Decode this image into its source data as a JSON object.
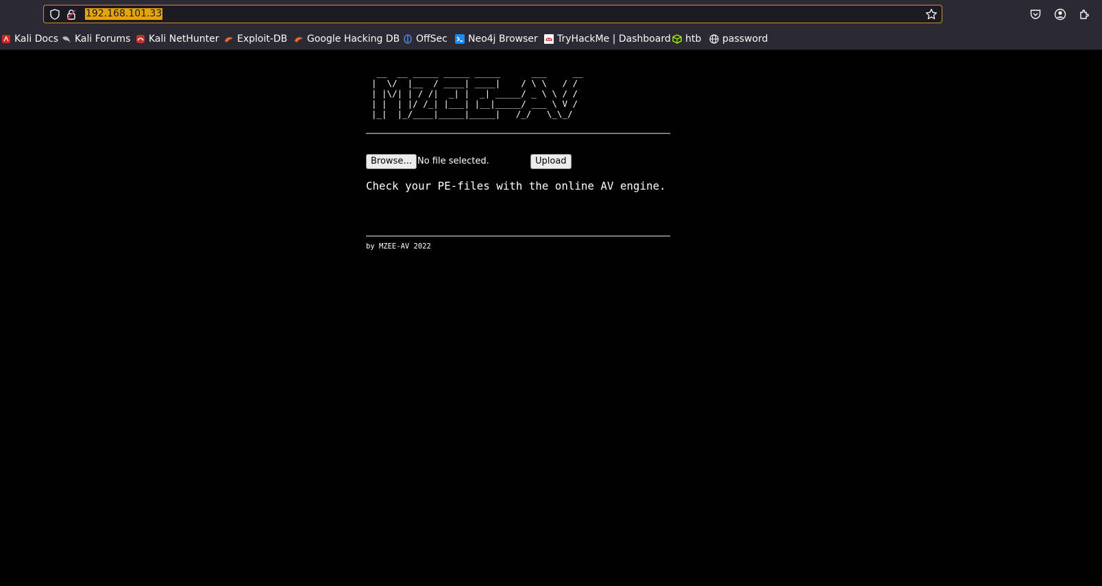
{
  "browser": {
    "url": "192.168.101.33",
    "bookmarks": [
      {
        "label": "Kali Docs",
        "icon": "kali-docs-icon"
      },
      {
        "label": "Kali Forums",
        "icon": "kali-dragon-icon"
      },
      {
        "label": "Kali NetHunter",
        "icon": "nethunter-icon"
      },
      {
        "label": "Exploit-DB",
        "icon": "exploit-db-icon"
      },
      {
        "label": "Google Hacking DB",
        "icon": "ghdb-icon"
      },
      {
        "label": "OffSec",
        "icon": "offsec-icon"
      },
      {
        "label": "Neo4j Browser",
        "icon": "neo4j-icon"
      },
      {
        "label": "TryHackMe | Dashboard",
        "icon": "tryhackme-icon"
      },
      {
        "label": "htb",
        "icon": "htb-cube-icon"
      },
      {
        "label": "password",
        "icon": "globe-icon"
      }
    ],
    "colors": {
      "chrome_bg": "#2b2a33",
      "url_highlight": "#e5a50a",
      "url_border": "#c49a27"
    }
  },
  "page": {
    "ascii_logo": " __  __ _____ _____ _____      ___     __\n|  \\/  |__  / ____| ____|    / \\ \\   / /\n| |\\/| | / /|  _| |  _| _____/ _ \\ \\ / / \n| |  | |/ /_| |___| |__|_____/ ___ \\ V /  \n|_|  |_/____|_____|_____|   /_/   \\_\\_/   ",
    "browse_label": "Browse…",
    "file_status": "No file selected.",
    "upload_label": "Upload",
    "tagline": "Check your PE-files with the online AV engine.",
    "footer": "by MZEE-AV 2022",
    "background": "#000000",
    "text_color": "#ffffff"
  }
}
